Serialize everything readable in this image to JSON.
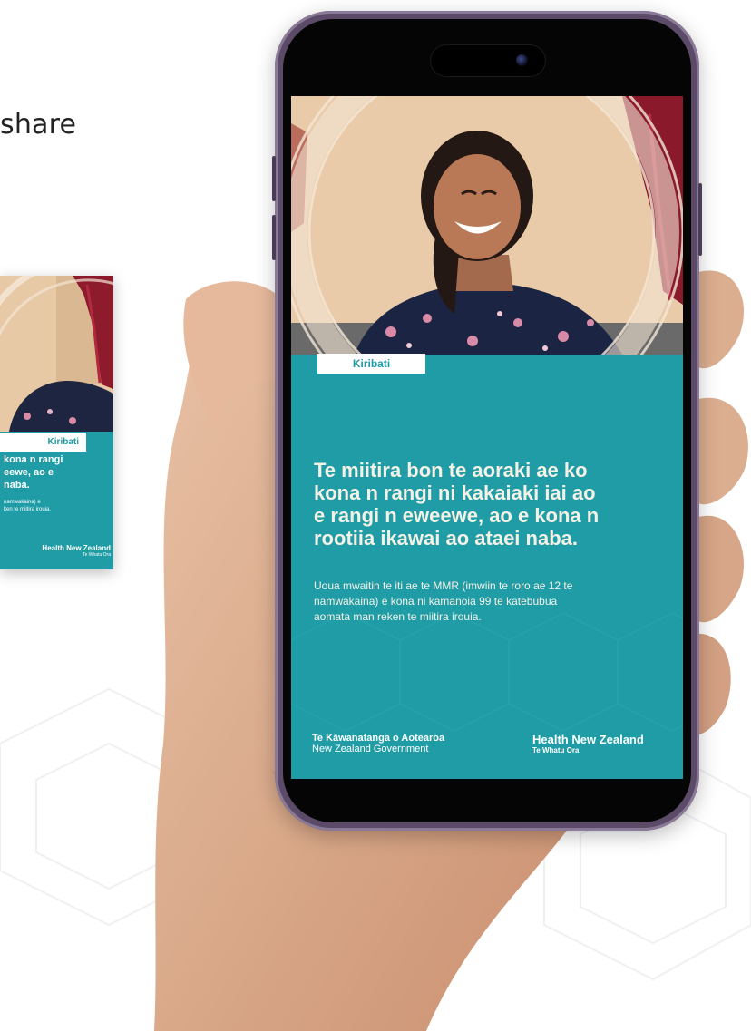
{
  "intro": {
    "share_text": "share"
  },
  "mini_poster": {
    "tag": "Kiribati",
    "headline": "kona n rangi\neewe, ao e\nnaba.",
    "body": "namwakaina) e\nken te miitira irouia.",
    "logo_main": "Health New Zealand",
    "logo_sub": "Te Whatu Ora"
  },
  "phone_screen": {
    "language_tag": "Kiribati",
    "headline": "Te miitira bon te aoraki ae ko\nkona n rangi ni kakaiaki iai ao\ne rangi n eweewe, ao e kona n\nrootiia ikawai ao ataei naba.",
    "body": "Uoua mwaitin te iti ae te MMR (imwiin te roro ae 12 te\nnamwakaina) e kona ni kamanoia 99 te katebubua\naomata man reken te miitira irouia.",
    "footer_left_title": "Te Kāwanatanga o Aotearoa",
    "footer_left_sub": "New Zealand Government",
    "footer_right_title": "Health New Zealand",
    "footer_right_sub": "Te Whatu Ora"
  },
  "colors": {
    "poster_teal": "#1f9ca6",
    "text_cream": "#f4f1e6",
    "phone_frame": "#5b4a68"
  }
}
